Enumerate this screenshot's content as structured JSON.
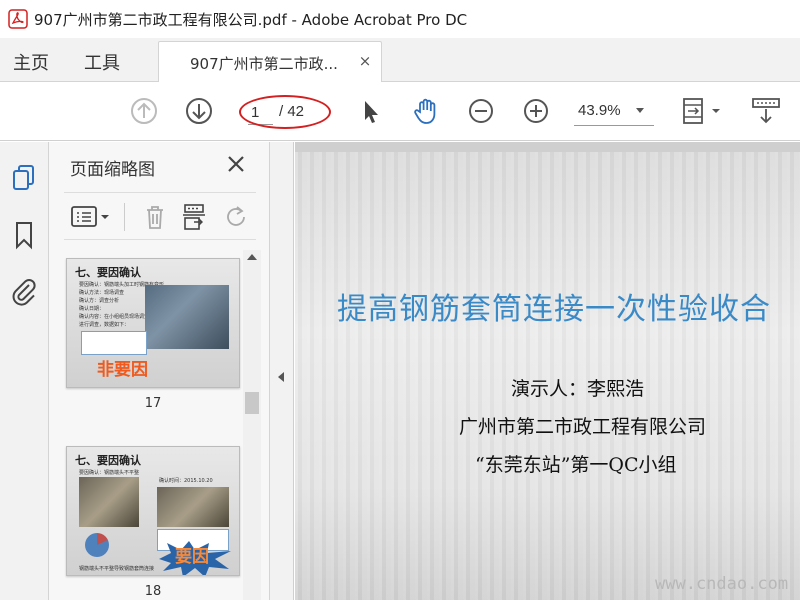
{
  "window": {
    "title": "907广州市第二市政工程有限公司.pdf - Adobe Acrobat Pro DC"
  },
  "menu": {
    "home": "主页",
    "tools": "工具"
  },
  "tab": {
    "label": "907广州市第二市政...",
    "close": "×"
  },
  "toolbar": {
    "page_current": "1",
    "page_total": "/ 42",
    "zoom": "43.9%"
  },
  "panel": {
    "title": "页面缩略图",
    "close": "×"
  },
  "thumbnails": [
    {
      "page": "17",
      "heading": "七、要因确认",
      "stamp": "非要因",
      "lines": [
        "要因确认：钢筋端头加工时钢筋有变形",
        "确认方法：现场调查",
        "确认方：调查分析",
        "确认日期：",
        "确认内容：在小组组员现场调查",
        "进行调查，数据如下："
      ]
    },
    {
      "page": "18",
      "heading": "七、要因确认",
      "stamp": "要因",
      "lines": [
        "要因确认：钢筋端头不平整",
        "确认时间：2015.10.20",
        "钢筋端头不平整导致钢筋套筒连接"
      ]
    }
  ],
  "slide": {
    "title": "提高钢筋套筒连接一次性验收合",
    "presenter": "演示人：李熙浩",
    "company": "广州市第二市政工程有限公司",
    "group": "“东莞东站”第一QC小组",
    "watermark": "www.cndao.com"
  },
  "colors": {
    "slide_title": "#3a8ac8",
    "highlight_ellipse": "#d42020",
    "acrobat_red": "#d42020"
  }
}
